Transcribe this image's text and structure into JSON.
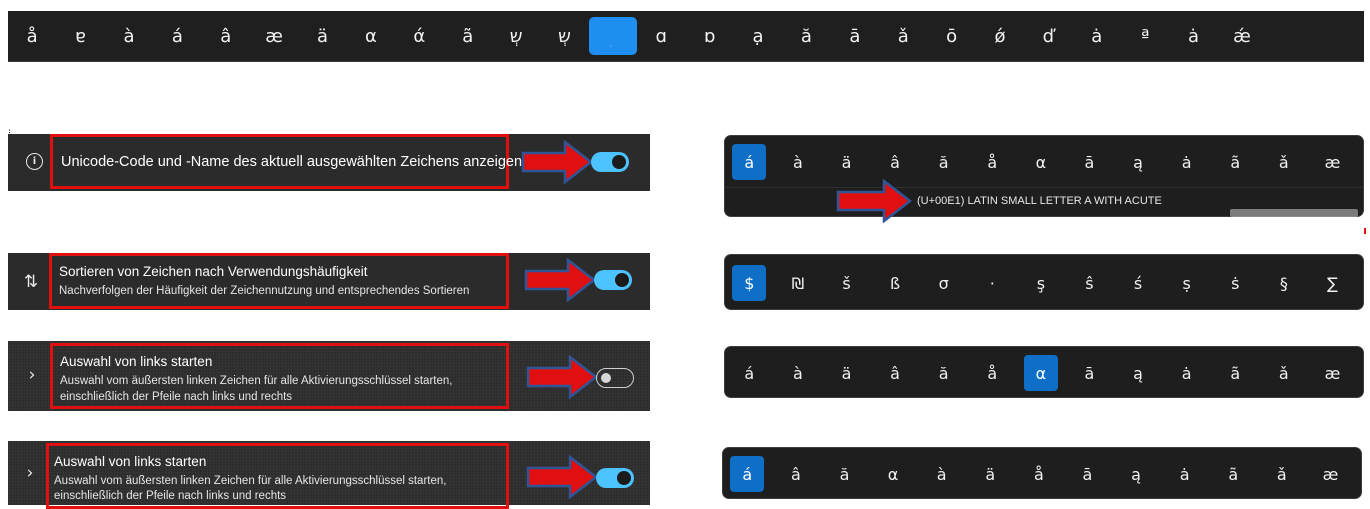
{
  "top_bar": {
    "chars": [
      "å",
      "ɐ",
      "à",
      "á",
      "â",
      "æ",
      "ä",
      "α",
      "ά",
      "ã",
      "שְ",
      "שְ",
      "̣",
      "ɑ",
      "ɒ",
      "ạ",
      "ă",
      "ā",
      "ǎ",
      "ō",
      "ǿ",
      "ď",
      "ȧ",
      "ª",
      "ȧ",
      "ǽ"
    ],
    "selected_index": 12
  },
  "settings": [
    {
      "icon": "info-icon",
      "title": "Unicode-Code und -Name des aktuell ausgewählten Zeichens anzeigen",
      "description": [],
      "toggle_on": true
    },
    {
      "icon": "sort-arrows-icon",
      "title": "Sortieren von Zeichen nach Verwendungshäufigkeit",
      "description": [
        "Nachverfolgen der Häufigkeit der Zeichennutzung und entsprechendes Sortieren"
      ],
      "toggle_on": true
    },
    {
      "icon": "chevron-right-icon",
      "title": "Auswahl von links starten",
      "description": [
        "Auswahl vom äußersten linken Zeichen für alle Aktivierungsschlüssel starten,",
        "einschließlich der Pfeile nach links und rechts"
      ],
      "toggle_on": false
    },
    {
      "icon": "chevron-right-icon",
      "title": "Auswahl von links starten",
      "description": [
        "Auswahl vom äußersten linken Zeichen für alle Aktivierungsschlüssel starten,",
        "einschließlich der Pfeile nach links und rechts"
      ],
      "toggle_on": true
    }
  ],
  "panels": [
    {
      "chars": [
        "á",
        "à",
        "ä",
        "â",
        "ă",
        "å",
        "α",
        "ā",
        "ą",
        "ȧ",
        "ã",
        "ǎ",
        "æ"
      ],
      "selected_index": 0,
      "unicode_label": "(U+00E1) LATIN SMALL LETTER A WITH ACUTE"
    },
    {
      "chars": [
        "$",
        "₪",
        "š",
        "ß",
        "σ",
        "·",
        "ş",
        "ŝ",
        "ś",
        "ṣ",
        "ṡ",
        "§",
        "∑"
      ],
      "selected_index": 0
    },
    {
      "chars": [
        "á",
        "à",
        "ä",
        "â",
        "ă",
        "å",
        "α",
        "ā",
        "ą",
        "ȧ",
        "ã",
        "ǎ",
        "æ"
      ],
      "selected_index": 6
    },
    {
      "chars": [
        "á",
        "â",
        "ă",
        "α",
        "à",
        "ä",
        "å",
        "ā",
        "ą",
        "ȧ",
        "ã",
        "ǎ",
        "æ"
      ],
      "selected_index": 0
    }
  ],
  "colors": {
    "accent": "#4cc2ff",
    "selection": "#0f6fc6",
    "highlight_box": "#e01010",
    "arrow_fill": "#e01010",
    "arrow_stroke": "#2f5597"
  }
}
